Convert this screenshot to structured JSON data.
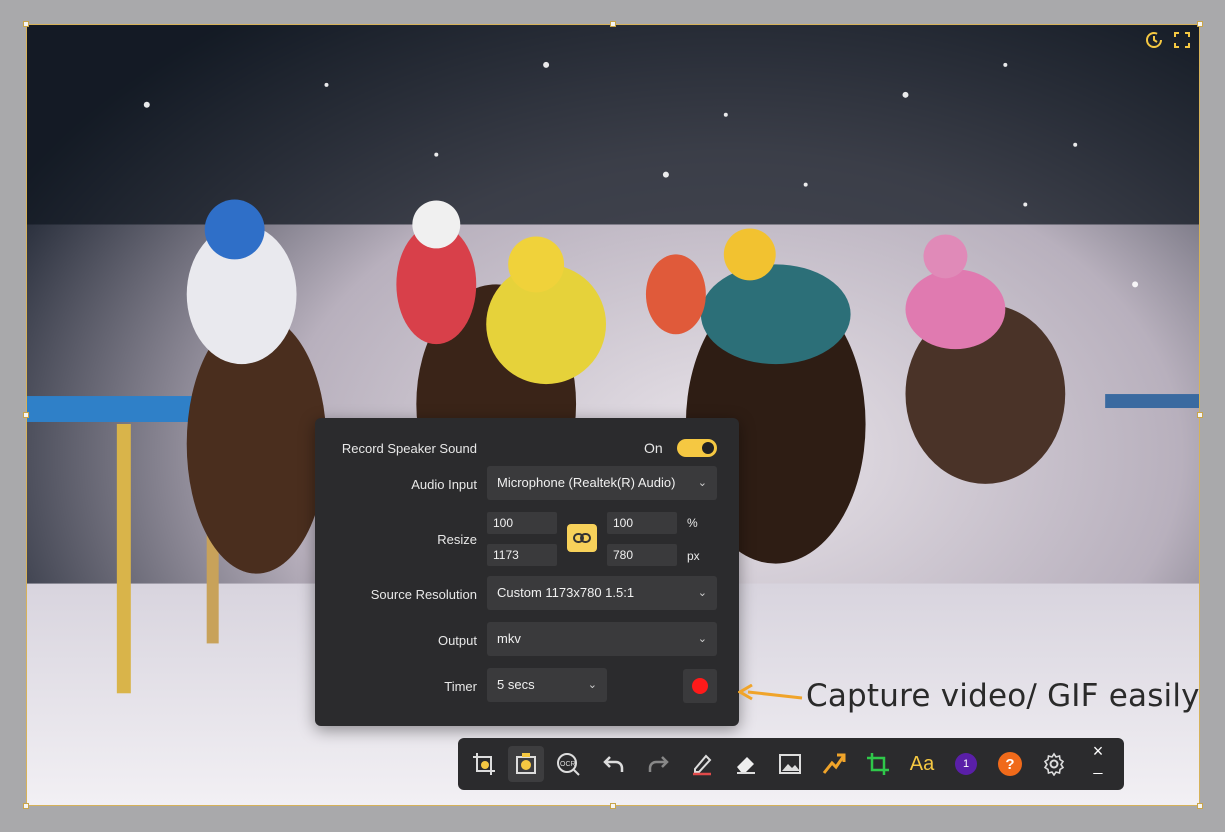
{
  "panel": {
    "speaker_label": "Record Speaker Sound",
    "speaker_state": "On",
    "audio_label": "Audio Input",
    "audio_value": "Microphone (Realtek(R) Audio)",
    "resize_label": "Resize",
    "width_percent": "100",
    "height_percent": "100",
    "percent_unit": "%",
    "width_px": "1173",
    "height_px": "780",
    "px_unit": "px",
    "source_label": "Source Resolution",
    "source_value": "Custom 1173x780 1.5:1",
    "output_label": "Output",
    "output_value": "mkv",
    "timer_label": "Timer",
    "timer_value": "5 secs"
  },
  "annotation": {
    "text": "Capture video/ GIF easily"
  },
  "toolbar": {
    "text_tool_label": "Aa",
    "step_badge": "1",
    "help_badge": "?",
    "close_glyph": "×",
    "minimize_glyph": "_"
  },
  "colors": {
    "accent": "#f5c842",
    "panel_bg": "#2b2b2d",
    "record": "#ff1a1a",
    "frame_border": "#d6b25a"
  },
  "icons": [
    "crop-icon",
    "duck-record-icon",
    "ocr-icon",
    "undo-icon",
    "redo-icon",
    "pen-icon",
    "eraser-icon",
    "image-icon",
    "arrow-icon",
    "rectangle-icon",
    "step-number-icon",
    "help-icon",
    "gear-icon",
    "timer-icon",
    "fullscreen-icon",
    "link-icon"
  ]
}
